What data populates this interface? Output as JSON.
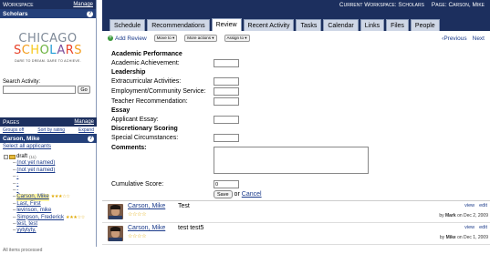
{
  "sidebar": {
    "workspace_label": "Workspace",
    "manage_label": "Manage",
    "workspace_name": "Scholars",
    "logo": {
      "line1": "CHICAGO",
      "line2": "SCHOLARS",
      "tagline": "DARE TO DREAM. DARE TO ACHIEVE."
    },
    "search_label": "Search Activity:",
    "go_label": "Go",
    "pages_label": "Pages",
    "pages_manage_label": "Manage",
    "groups_off_label": "Groups off",
    "sort_label": "Sort by rating",
    "expand_label": "Expand",
    "student_name": "Carson, Mike",
    "select_all_label": "Select all applicants",
    "tree_root_label": "draft",
    "tree_root_count": "(11)",
    "tree_items": [
      {
        "label": "(not yet named)",
        "stars": ""
      },
      {
        "label": "(not yet named)",
        "stars": ""
      },
      {
        "label": "-",
        "stars": ""
      },
      {
        "label": "-",
        "stars": ""
      },
      {
        "label": "-",
        "stars": ""
      },
      {
        "label": "Carson, Mike",
        "stars": "★★★☆☆"
      },
      {
        "label": "Last, First",
        "stars": ""
      },
      {
        "label": "levinson, mike",
        "stars": ""
      },
      {
        "label": "Simpson, Frederick",
        "stars": "★★★☆☆"
      },
      {
        "label": "test, test",
        "stars": ""
      },
      {
        "label": "yytytyty,",
        "stars": ""
      }
    ],
    "status_text": "All items processed"
  },
  "header": {
    "workspace_label": "Current Workspace:",
    "workspace_value": "Scholars",
    "page_label": "Page:",
    "page_value": "Carson, Mike"
  },
  "tabs": [
    {
      "label": "Schedule"
    },
    {
      "label": "Recommendations"
    },
    {
      "label": "Review"
    },
    {
      "label": "Recent Activity"
    },
    {
      "label": "Tasks"
    },
    {
      "label": "Calendar"
    },
    {
      "label": "Links"
    },
    {
      "label": "Files"
    },
    {
      "label": "People"
    }
  ],
  "toolbar": {
    "add_review_label": "Add Review",
    "move_to_label": "Move to ▾",
    "more_actions_label": "More actions ▾",
    "assign_to_label": "Assign to ▾",
    "previous_label": "‹Previous",
    "next_label": "Next"
  },
  "form": {
    "sections": {
      "academic": "Academic Performance",
      "leadership": "Leadership",
      "essay": "Essay",
      "discretionary": "Discretionary Scoring"
    },
    "fields": {
      "academic_achievement": "Academic Achievement:",
      "extracurricular": "Extracurricular Activities:",
      "employment": "Employment/Community Service:",
      "teacher_rec": "Teacher Recommendation:",
      "applicant_essay": "Applicant Essay:",
      "special_circumstances": "Special Circumstances:"
    },
    "comments_label": "Comments:",
    "cumulative_label": "Cumulative Score:",
    "cumulative_value": "0",
    "save_label": "Save",
    "or_label": "or",
    "cancel_label": "Cancel"
  },
  "reviews": [
    {
      "name": "Carson, Mike",
      "stars": "☆☆☆☆",
      "text": "Test",
      "view": "view",
      "edit": "edit",
      "by_label": "by",
      "author": "Mark",
      "date": "on Dec 2, 2009"
    },
    {
      "name": "Carson, Mike",
      "stars": "☆☆☆☆",
      "text": "test test5",
      "view": "view",
      "edit": "edit",
      "by_label": "by",
      "author": "Mike",
      "date": "on Dec 1, 2009"
    }
  ],
  "colors": {
    "header_navy": "#1c2f5e",
    "subheader_blue": "#24407a",
    "link_blue": "#1a3a8a",
    "tab_inactive": "#cfd7e6",
    "star_gold": "#e0a800"
  },
  "logo_colors": [
    "#e8432a",
    "#f39c1a",
    "#f7c91c",
    "#6cb33f",
    "#1f9bd7",
    "#7d4f9c",
    "#e8432a",
    "#f39c1a"
  ]
}
